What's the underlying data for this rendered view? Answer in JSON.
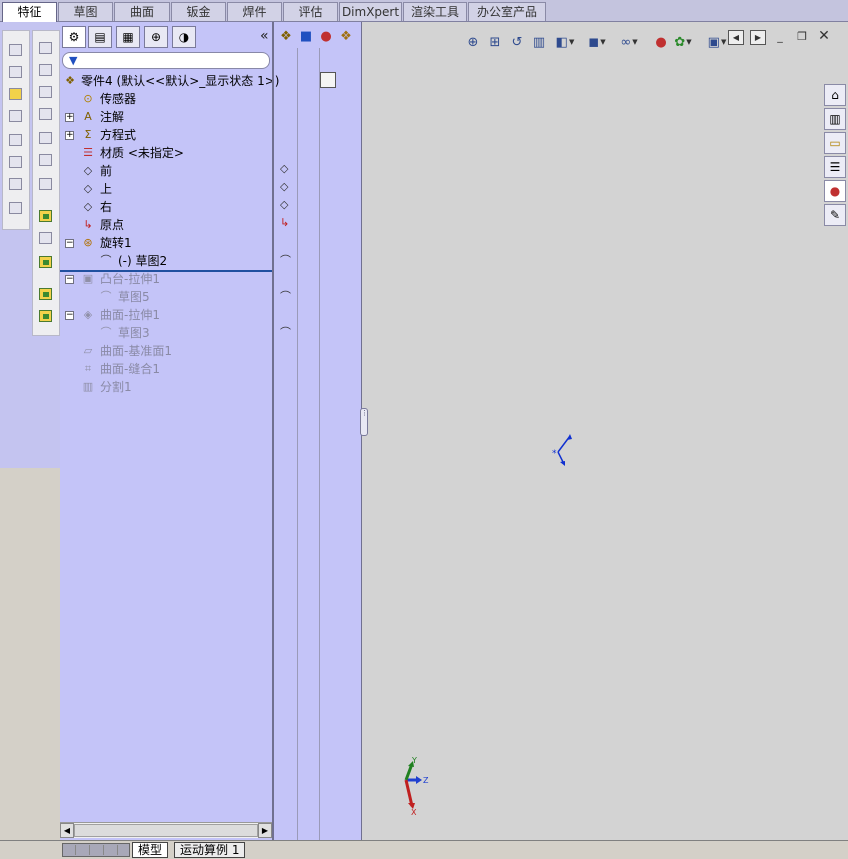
{
  "command_tabs": [
    "特征",
    "草图",
    "曲面",
    "钣金",
    "焊件",
    "评估",
    "DimXpert",
    "渲染工具",
    "办公室产品"
  ],
  "active_tab": "特征",
  "feature_tree": {
    "root": "零件4 (默认<<默认>_显示状态 1>)",
    "nodes": [
      {
        "label": "传感器",
        "icon": "sensor-icon",
        "expand": "",
        "dim": false
      },
      {
        "label": "注解",
        "icon": "annotation-icon",
        "expand": "+",
        "dim": false
      },
      {
        "label": "方程式",
        "icon": "equation-icon",
        "expand": "+",
        "dim": false
      },
      {
        "label": "材质 <未指定>",
        "icon": "material-icon",
        "expand": "",
        "dim": false
      },
      {
        "label": "前",
        "icon": "plane-icon",
        "expand": "",
        "dim": false
      },
      {
        "label": "上",
        "icon": "plane-icon",
        "expand": "",
        "dim": false
      },
      {
        "label": "右",
        "icon": "plane-icon",
        "expand": "",
        "dim": false
      },
      {
        "label": "原点",
        "icon": "origin-icon",
        "expand": "",
        "dim": false
      },
      {
        "label": "旋转1",
        "icon": "revolve-icon",
        "expand": "−",
        "dim": false
      },
      {
        "label": "(-) 草图2",
        "icon": "sketch-icon",
        "expand": "",
        "dim": false
      },
      {
        "label": "凸台-拉伸1",
        "icon": "extrude-icon",
        "expand": "−",
        "dim": true
      },
      {
        "label": "草图5",
        "icon": "sketch-icon",
        "expand": "",
        "dim": true
      },
      {
        "label": "曲面-拉伸1",
        "icon": "surface-extrude-icon",
        "expand": "−",
        "dim": true
      },
      {
        "label": "草图3",
        "icon": "sketch-icon",
        "expand": "",
        "dim": true
      },
      {
        "label": "曲面-基准面1",
        "icon": "surface-plane-icon",
        "expand": "",
        "dim": true
      },
      {
        "label": "曲面-缝合1",
        "icon": "knit-icon",
        "expand": "",
        "dim": true
      },
      {
        "label": "分割1",
        "icon": "split-icon",
        "expand": "",
        "dim": true
      }
    ]
  },
  "axes": {
    "x": "X",
    "y": "Y",
    "z": "Z"
  },
  "bottom_tabs": [
    "模型",
    "运动算例 1"
  ],
  "active_bottom_tab": "模型",
  "colors": {
    "panel": "#c4c4f8",
    "graphics": "#d3d3d3",
    "rollback_bar": "#2050a0"
  }
}
